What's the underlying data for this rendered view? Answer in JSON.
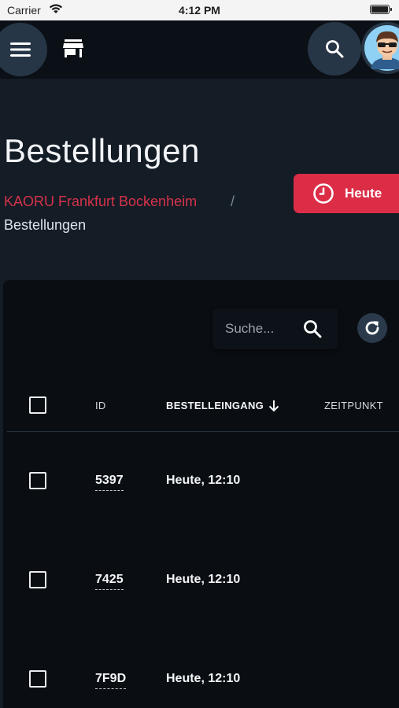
{
  "statusbar": {
    "carrier": "Carrier",
    "time": "4:12 PM"
  },
  "appbar": {
    "menu_icon": "menu-icon",
    "store_icon": "store-icon",
    "search_icon": "search-icon",
    "avatar_icon": "avatar"
  },
  "header": {
    "title": "Bestellungen",
    "breadcrumb": {
      "parent": "KAORU Frankfurt Bockenheim",
      "separator": "/",
      "current": "Bestellungen"
    },
    "date_filter_label": "Heute"
  },
  "table": {
    "search_placeholder": "Suche...",
    "columns": [
      "ID",
      "BESTELLEINGANG",
      "ZEITPUNKT"
    ],
    "sort_column": "BESTELLEINGANG",
    "sort_direction": "descending",
    "rows": [
      {
        "id": "5397",
        "received": "Heute, 12:10"
      },
      {
        "id": "7425",
        "received": "Heute, 12:10"
      },
      {
        "id": "7F9D",
        "received": "Heute, 12:10"
      }
    ]
  },
  "colors": {
    "accent": "#dc2d47",
    "background": "#141c26",
    "card": "#0a0e13"
  }
}
